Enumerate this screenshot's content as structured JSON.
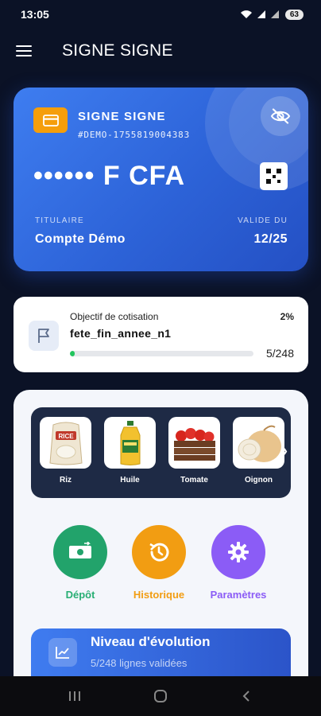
{
  "status": {
    "time": "13:05",
    "battery": "63"
  },
  "app_bar": {
    "title": "SIGNE SIGNE"
  },
  "card": {
    "brand": "SIGNE SIGNE",
    "account_id": "#DEMO-1755819004383",
    "balance": "•••••• F CFA",
    "holder_label": "TITULAIRE",
    "holder_name": "Compte Démo",
    "valid_label": "VALIDE DU",
    "valid_date": "12/25"
  },
  "goal": {
    "caption": "Objectif de cotisation",
    "percent": "2%",
    "name": "fete_fin_annee_n1",
    "count": "5/248",
    "progress": 0.02
  },
  "products": [
    {
      "label": "Riz",
      "icon": "rice-bag-icon"
    },
    {
      "label": "Huile",
      "icon": "oil-bottle-icon"
    },
    {
      "label": "Tomate",
      "icon": "tomato-crate-icon"
    },
    {
      "label": "Oignon",
      "icon": "onion-icon"
    }
  ],
  "actions": [
    {
      "label": "Dépôt",
      "color": "#22a36b",
      "text_color": "#27ae73",
      "icon": "deposit-icon"
    },
    {
      "label": "Historique",
      "color": "#f29d12",
      "text_color": "#f29d12",
      "icon": "history-icon"
    },
    {
      "label": "Paramètres",
      "color": "#8b5cf6",
      "text_color": "#8b5cf6",
      "icon": "settings-icon"
    }
  ],
  "level": {
    "title": "Niveau d'évolution",
    "subtitle": "5/248 lignes validées"
  },
  "colors": {
    "card_blue": "#3e7df0",
    "goal_green": "#22c55e",
    "chip_orange": "#f59e0b",
    "background": "#0b1226"
  }
}
